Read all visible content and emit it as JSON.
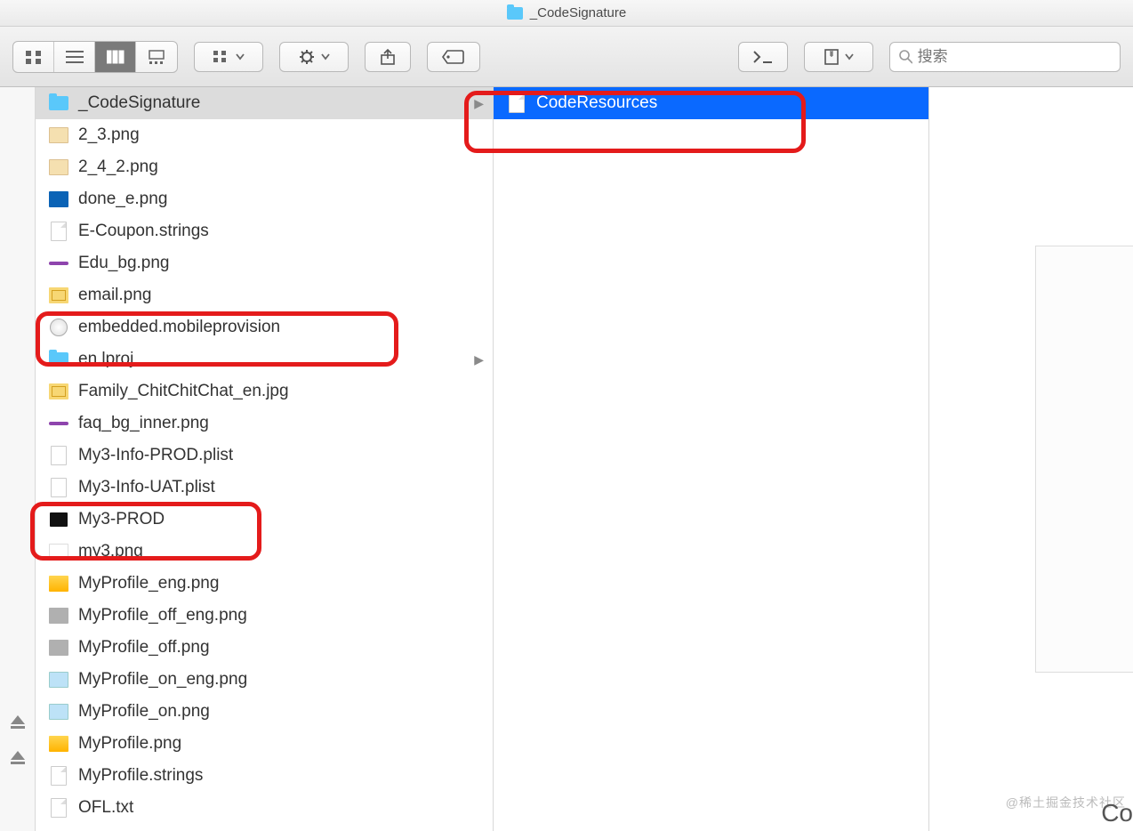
{
  "window": {
    "title": "_CodeSignature"
  },
  "toolbar": {
    "search_placeholder": "搜索"
  },
  "column1": {
    "items": [
      {
        "name": "_CodeSignature",
        "icon": "folder",
        "isFolder": true,
        "selected": true
      },
      {
        "name": "2_3.png",
        "icon": "png"
      },
      {
        "name": "2_4_2.png",
        "icon": "png"
      },
      {
        "name": "done_e.png",
        "icon": "blue"
      },
      {
        "name": "E-Coupon.strings",
        "icon": "doc"
      },
      {
        "name": "Edu_bg.png",
        "icon": "line"
      },
      {
        "name": "email.png",
        "icon": "yel"
      },
      {
        "name": "embedded.mobileprovision",
        "icon": "prov"
      },
      {
        "name": "en.lproj",
        "icon": "folder",
        "isFolder": true
      },
      {
        "name": "Family_ChitChitChat_en.jpg",
        "icon": "yel"
      },
      {
        "name": "faq_bg_inner.png",
        "icon": "line"
      },
      {
        "name": "My3-Info-PROD.plist",
        "icon": "plist"
      },
      {
        "name": "My3-Info-UAT.plist",
        "icon": "plist"
      },
      {
        "name": "My3-PROD",
        "icon": "exec"
      },
      {
        "name": "my3.png",
        "icon": "blank"
      },
      {
        "name": "MyProfile_eng.png",
        "icon": "gold"
      },
      {
        "name": "MyProfile_off_eng.png",
        "icon": "grey"
      },
      {
        "name": "MyProfile_off.png",
        "icon": "grey"
      },
      {
        "name": "MyProfile_on_eng.png",
        "icon": "png2"
      },
      {
        "name": "MyProfile_on.png",
        "icon": "png2"
      },
      {
        "name": "MyProfile.png",
        "icon": "gold"
      },
      {
        "name": "MyProfile.strings",
        "icon": "doc"
      },
      {
        "name": "OFL.txt",
        "icon": "doc"
      }
    ]
  },
  "column2": {
    "items": [
      {
        "name": "CodeResources",
        "icon": "doc",
        "selected": true
      }
    ]
  },
  "watermark": "@稀土掘金技术社区",
  "preview_label": "Co"
}
